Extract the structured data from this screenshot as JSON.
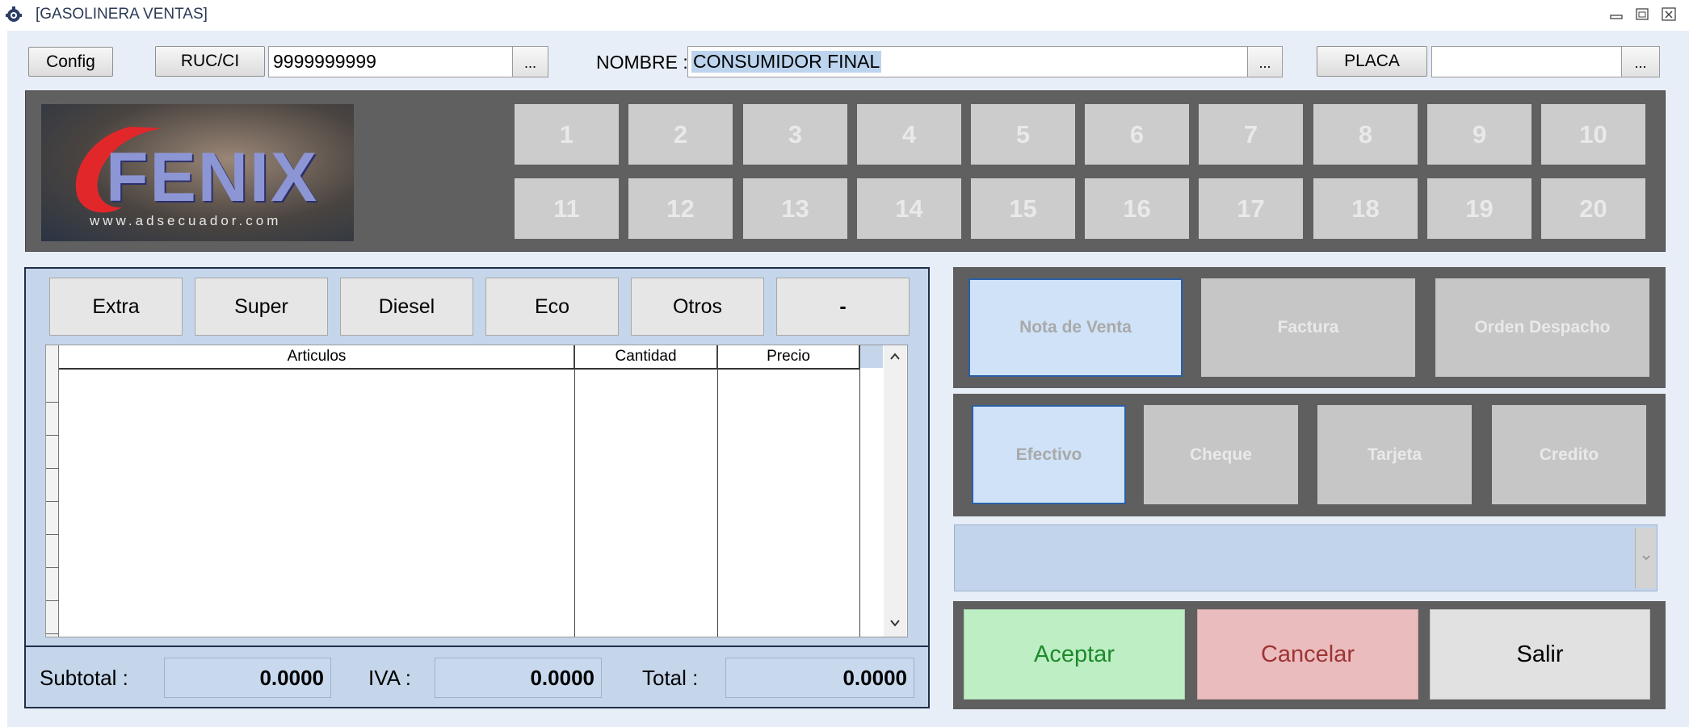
{
  "window": {
    "title": "[GASOLINERA VENTAS]"
  },
  "header": {
    "config_label": "Config",
    "ruc_label": "RUC/CI",
    "ruc_value": "9999999999",
    "ruc_lookup": "...",
    "nombre_label": "NOMBRE :",
    "nombre_value": "CONSUMIDOR FINAL",
    "nombre_lookup": "...",
    "placa_label": "PLACA",
    "placa_value": "",
    "placa_lookup": "..."
  },
  "logo": {
    "brand": "FENIX",
    "url": "www.adsecuador.com"
  },
  "pumps": [
    "1",
    "2",
    "3",
    "4",
    "5",
    "6",
    "7",
    "8",
    "9",
    "10",
    "11",
    "12",
    "13",
    "14",
    "15",
    "16",
    "17",
    "18",
    "19",
    "20"
  ],
  "fuels": [
    "Extra",
    "Super",
    "Diesel",
    "Eco",
    "Otros",
    "-"
  ],
  "grid": {
    "columns": [
      "Articulos",
      "Cantidad",
      "Precio"
    ],
    "rows": []
  },
  "totals": {
    "subtotal_label": "Subtotal :",
    "subtotal_value": "0.0000",
    "iva_label": "IVA :",
    "iva_value": "0.0000",
    "total_label": "Total :",
    "total_value": "0.0000"
  },
  "document_types": [
    "Nota de Venta",
    "Factura",
    "Orden Despacho"
  ],
  "payment_types": [
    "Efectivo",
    "Cheque",
    "Tarjeta",
    "Credito"
  ],
  "payment_select": {
    "value": ""
  },
  "actions": {
    "accept": "Aceptar",
    "cancel": "Cancelar",
    "exit": "Salir"
  },
  "colors": {
    "accept_bg": "#bdeec4",
    "accept_text": "#1e8a2a",
    "cancel_bg": "#ebbcbe",
    "cancel_text": "#9d3434",
    "exit_bg": "#e1e1e1",
    "active_option_bg": "#cfe2f7"
  }
}
